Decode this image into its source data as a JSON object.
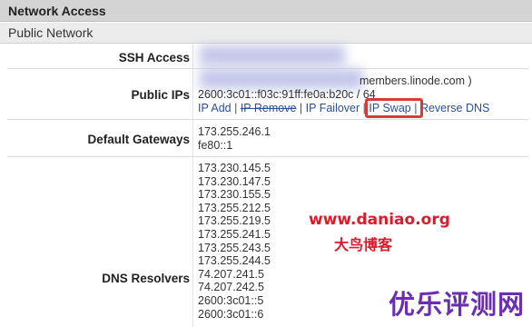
{
  "header": {
    "title": "Network Access"
  },
  "section": {
    "title": "Public Network"
  },
  "rows": {
    "ssh": {
      "label": "SSH Access"
    },
    "public_ips": {
      "label": "Public IPs",
      "host_suffix": "members.linode.com )",
      "ipv6": "2600:3c01::f03c:91ff:fe0a:b20c / 64",
      "links": {
        "ip_add": "IP Add",
        "ip_remove": "IP Remove",
        "ip_failover": "IP Failover",
        "ip_swap": "IP Swap",
        "reverse_dns": "Reverse DNS"
      }
    },
    "gateways": {
      "label": "Default Gateways",
      "values": [
        "173.255.246.1",
        "fe80::1"
      ]
    },
    "dns": {
      "label": "DNS Resolvers",
      "values": [
        "173.230.145.5",
        "173.230.147.5",
        "173.230.155.5",
        "173.255.212.5",
        "173.255.219.5",
        "173.255.241.5",
        "173.255.243.5",
        "173.255.244.5",
        "74.207.241.5",
        "74.207.242.5",
        "2600:3c01::5",
        "2600:3c01::6"
      ]
    }
  },
  "watermarks": {
    "url": "www.daniao.org",
    "cn_small": "大鸟博客",
    "cn_big": "优乐评测网"
  },
  "colors": {
    "highlight": "#d43b3b",
    "link": "#2b4f9a",
    "watermark_red": "#e0192a",
    "watermark_purple": "#6a2fb0"
  }
}
